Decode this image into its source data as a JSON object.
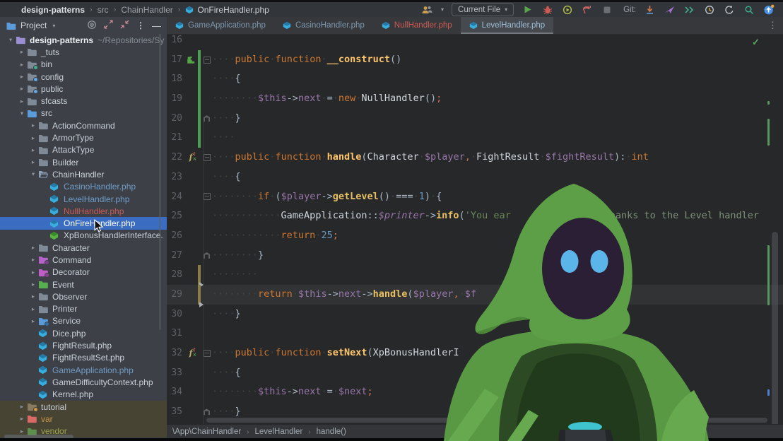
{
  "window": {
    "breadcrumbs": [
      {
        "label": "design-patterns",
        "bold": true
      },
      {
        "label": "src"
      },
      {
        "label": "ChainHandler"
      },
      {
        "label": "OnFireHandler.php",
        "icon": "php-class"
      }
    ],
    "toolbar": {
      "run_config_label": "Current File",
      "git_label": "Git:"
    }
  },
  "project_panel": {
    "title": "Project",
    "tree": [
      {
        "label": "design-patterns",
        "suffix": "~/Repositories/Sy",
        "lvl": 0,
        "chev": "open",
        "icon": "folder-root",
        "text": "bold"
      },
      {
        "label": "_tuts",
        "lvl": 1,
        "chev": "closed",
        "icon": "folder"
      },
      {
        "label": "bin",
        "lvl": 1,
        "chev": "closed",
        "icon": "folder-bin"
      },
      {
        "label": "config",
        "lvl": 1,
        "chev": "closed",
        "icon": "folder-config"
      },
      {
        "label": "public",
        "lvl": 1,
        "chev": "closed",
        "icon": "folder-public"
      },
      {
        "label": "sfcasts",
        "lvl": 1,
        "chev": "closed",
        "icon": "folder"
      },
      {
        "label": "src",
        "lvl": 1,
        "chev": "open",
        "icon": "folder-src"
      },
      {
        "label": "ActionCommand",
        "lvl": 2,
        "chev": "closed",
        "icon": "folder"
      },
      {
        "label": "ArmorType",
        "lvl": 2,
        "chev": "closed",
        "icon": "folder"
      },
      {
        "label": "AttackType",
        "lvl": 2,
        "chev": "closed",
        "icon": "folder"
      },
      {
        "label": "Builder",
        "lvl": 2,
        "chev": "closed",
        "icon": "folder"
      },
      {
        "label": "ChainHandler",
        "lvl": 2,
        "chev": "open",
        "icon": "folder-open"
      },
      {
        "label": "CasinoHandler.php",
        "lvl": 3,
        "icon": "class",
        "text": "open-file"
      },
      {
        "label": "LevelHandler.php",
        "lvl": 3,
        "icon": "class",
        "text": "open-file"
      },
      {
        "label": "NullHandler.php",
        "lvl": 3,
        "icon": "class",
        "text": "error"
      },
      {
        "label": "OnFireHandler.php",
        "lvl": 3,
        "icon": "class",
        "row": "selected"
      },
      {
        "label": "XpBonusHandlerInterface.",
        "lvl": 3,
        "icon": "interface"
      },
      {
        "label": "Character",
        "lvl": 2,
        "chev": "closed",
        "icon": "folder"
      },
      {
        "label": "Command",
        "lvl": 2,
        "chev": "closed",
        "icon": "folder-command"
      },
      {
        "label": "Decorator",
        "lvl": 2,
        "chev": "closed",
        "icon": "folder-decorator"
      },
      {
        "label": "Event",
        "lvl": 2,
        "chev": "closed",
        "icon": "folder-event"
      },
      {
        "label": "Observer",
        "lvl": 2,
        "chev": "closed",
        "icon": "folder"
      },
      {
        "label": "Printer",
        "lvl": 2,
        "chev": "closed",
        "icon": "folder"
      },
      {
        "label": "Service",
        "lvl": 2,
        "chev": "closed",
        "icon": "folder-service"
      },
      {
        "label": "Dice.php",
        "lvl": 2,
        "icon": "class"
      },
      {
        "label": "FightResult.php",
        "lvl": 2,
        "icon": "class"
      },
      {
        "label": "FightResultSet.php",
        "lvl": 2,
        "icon": "class"
      },
      {
        "label": "GameApplication.php",
        "lvl": 2,
        "icon": "class",
        "text": "open-file"
      },
      {
        "label": "GameDifficultyContext.php",
        "lvl": 2,
        "icon": "class"
      },
      {
        "label": "Kernel.php",
        "lvl": 2,
        "icon": "class"
      },
      {
        "label": "tutorial",
        "lvl": 1,
        "chev": "closed",
        "icon": "folder-tutorial",
        "row": "excluded"
      },
      {
        "label": "var",
        "lvl": 1,
        "chev": "closed",
        "icon": "folder-var",
        "row": "excluded",
        "text": "excluded"
      },
      {
        "label": "vendor",
        "lvl": 1,
        "chev": "closed",
        "icon": "folder-vendor",
        "row": "excluded",
        "text": "vendor"
      }
    ]
  },
  "editor_tabs": [
    {
      "label": "GameApplication.php",
      "state": "normal"
    },
    {
      "label": "CasinoHandler.php",
      "state": "normal"
    },
    {
      "label": "NullHandler.php",
      "state": "error"
    },
    {
      "label": "LevelHandler.php",
      "state": "active"
    }
  ],
  "editor": {
    "inspection_status": "✓",
    "lines": [
      {
        "n": 16,
        "seg": []
      },
      {
        "n": 17,
        "gutter": "symfony",
        "change": "g",
        "fold": "s",
        "seg": [
          [
            "w",
            "····"
          ],
          [
            "k",
            "public"
          ],
          [
            "w",
            "·"
          ],
          [
            "k",
            "function"
          ],
          [
            "w",
            "·"
          ],
          [
            "m",
            "__construct"
          ],
          [
            "p",
            "()"
          ]
        ]
      },
      {
        "n": 18,
        "change": "g",
        "seg": [
          [
            "w",
            "····"
          ],
          [
            "p",
            "{"
          ]
        ]
      },
      {
        "n": 19,
        "change": "g",
        "seg": [
          [
            "w",
            "········"
          ],
          [
            "v",
            "$this"
          ],
          [
            "o",
            "->"
          ],
          [
            "v",
            "next"
          ],
          [
            "w",
            "·"
          ],
          [
            "o",
            "="
          ],
          [
            "w",
            "·"
          ],
          [
            "k",
            "new"
          ],
          [
            "w",
            "·"
          ],
          [
            "c",
            "NullHandler"
          ],
          [
            "p",
            "()"
          ],
          [
            "x",
            ";"
          ]
        ]
      },
      {
        "n": 20,
        "change": "g",
        "fold": "e",
        "seg": [
          [
            "w",
            "····"
          ],
          [
            "p",
            "}"
          ]
        ]
      },
      {
        "n": 21,
        "change": "g",
        "seg": [
          [
            "w",
            "····"
          ]
        ]
      },
      {
        "n": 22,
        "gutter": "override",
        "fold": "s",
        "seg": [
          [
            "w",
            "····"
          ],
          [
            "k",
            "public"
          ],
          [
            "w",
            "·"
          ],
          [
            "k",
            "function"
          ],
          [
            "w",
            "·"
          ],
          [
            "m",
            "handle"
          ],
          [
            "p",
            "("
          ],
          [
            "c",
            "Character"
          ],
          [
            "w",
            "·"
          ],
          [
            "v",
            "$player"
          ],
          [
            "x",
            ","
          ],
          [
            "w",
            "·"
          ],
          [
            "c",
            "FightResult"
          ],
          [
            "w",
            "·"
          ],
          [
            "v",
            "$fightResult"
          ],
          [
            "p",
            ")"
          ],
          [
            "o",
            ":"
          ],
          [
            "w",
            "·"
          ],
          [
            "k",
            "int"
          ]
        ]
      },
      {
        "n": 23,
        "seg": [
          [
            "w",
            "····"
          ],
          [
            "p",
            "{"
          ]
        ]
      },
      {
        "n": 24,
        "fold": "s",
        "seg": [
          [
            "w",
            "········"
          ],
          [
            "k",
            "if"
          ],
          [
            "w",
            "·"
          ],
          [
            "p",
            "("
          ],
          [
            "v",
            "$player"
          ],
          [
            "o",
            "->"
          ],
          [
            "f",
            "getLevel"
          ],
          [
            "p",
            "()"
          ],
          [
            "w",
            "·"
          ],
          [
            "o",
            "==="
          ],
          [
            "w",
            "·"
          ],
          [
            "n",
            "1"
          ],
          [
            "p",
            ")"
          ],
          [
            "w",
            "·"
          ],
          [
            "p",
            "{"
          ]
        ]
      },
      {
        "n": 25,
        "seg": [
          [
            "w",
            "············"
          ],
          [
            "c",
            "GameApplication"
          ],
          [
            "o",
            "::"
          ],
          [
            "sv",
            "$printer"
          ],
          [
            "o",
            "->"
          ],
          [
            "f",
            "info"
          ],
          [
            "p",
            "("
          ],
          [
            "s",
            "'You ear"
          ],
          [
            "gap",
            "140"
          ],
          [
            "sf",
            "hanks to the Level handler"
          ]
        ]
      },
      {
        "n": 26,
        "seg": [
          [
            "w",
            "············"
          ],
          [
            "k",
            "return"
          ],
          [
            "w",
            "·"
          ],
          [
            "n",
            "25"
          ],
          [
            "x",
            ";"
          ]
        ]
      },
      {
        "n": 27,
        "fold": "e",
        "seg": [
          [
            "w",
            "········"
          ],
          [
            "p",
            "}"
          ]
        ]
      },
      {
        "n": 28,
        "change": "o",
        "seg": [
          [
            "w",
            "········"
          ]
        ]
      },
      {
        "n": 29,
        "caret": true,
        "change": "o",
        "seg": [
          [
            "w",
            "········"
          ],
          [
            "k",
            "return"
          ],
          [
            "w",
            "·"
          ],
          [
            "v",
            "$this"
          ],
          [
            "o",
            "->"
          ],
          [
            "v",
            "next"
          ],
          [
            "o",
            "->"
          ],
          [
            "f",
            "handle"
          ],
          [
            "p",
            "("
          ],
          [
            "v",
            "$player"
          ],
          [
            "x",
            ","
          ],
          [
            "w",
            "·"
          ],
          [
            "v",
            "$f"
          ]
        ]
      },
      {
        "n": 30,
        "seg": [
          [
            "w",
            "····"
          ],
          [
            "p",
            "}"
          ]
        ]
      },
      {
        "n": 31,
        "seg": []
      },
      {
        "n": 32,
        "gutter": "override",
        "fold": "s",
        "seg": [
          [
            "w",
            "····"
          ],
          [
            "k",
            "public"
          ],
          [
            "w",
            "·"
          ],
          [
            "k",
            "function"
          ],
          [
            "w",
            "·"
          ],
          [
            "m",
            "setNext"
          ],
          [
            "p",
            "("
          ],
          [
            "c",
            "XpBonusHandlerI"
          ]
        ]
      },
      {
        "n": 33,
        "seg": [
          [
            "w",
            "····"
          ],
          [
            "p",
            "{"
          ]
        ]
      },
      {
        "n": 34,
        "seg": [
          [
            "w",
            "········"
          ],
          [
            "v",
            "$this"
          ],
          [
            "o",
            "->"
          ],
          [
            "v",
            "next"
          ],
          [
            "w",
            "·"
          ],
          [
            "o",
            "="
          ],
          [
            "w",
            "·"
          ],
          [
            "v",
            "$next"
          ],
          [
            "x",
            ";"
          ]
        ]
      },
      {
        "n": 35,
        "fold": "e",
        "seg": [
          [
            "w",
            "····"
          ],
          [
            "p",
            "}"
          ]
        ]
      }
    ]
  },
  "status_bar": {
    "breadcrumbs": [
      "\\App\\ChainHandler",
      "LevelHandler",
      "handle()"
    ]
  },
  "colors": {
    "selection_blue": "#3a6cc1",
    "excluded_row": "#474433",
    "keyword_orange": "#cc7832",
    "string_green": "#6a8759",
    "error_red": "#cd5a54",
    "change_green": "#4f9b53",
    "change_modified": "#8a7d4a",
    "mascot_green": "#5d9f47",
    "mascot_face": "#2b1f36",
    "mascot_eyes": "#5cb5e9",
    "icons": {
      "folder": "#7f8a96",
      "folder-root": "#9a8fd2",
      "folder-src": "#5b9bd8",
      "folder-open": "#7f8a96",
      "folder-bin": "#7f8a96",
      "folder-config": "#7f8a96",
      "folder-public": "#7f8a96",
      "folder-command": "#b464c8",
      "folder-decorator": "#c05fc3",
      "folder-event": "#57b04f",
      "folder-service": "#5b9bd8",
      "folder-tutorial": "#8a7a5f",
      "folder-var": "#d96a66",
      "folder-vendor": "#5f8f4f",
      "class": "#38aede",
      "class-dark": "#2579a5",
      "interface": "#56b33e",
      "interface-dark": "#378c2a"
    },
    "badges": {
      "folder-bin": "#3fae8e",
      "folder-config": "#62a8e8",
      "folder-public": "#62a8e8",
      "folder-tutorial": "#d29a3a",
      "folder-command": "#7d3f8f",
      "folder-decorator": "#8f3f93",
      "folder-service": "#2f6ea8"
    }
  }
}
